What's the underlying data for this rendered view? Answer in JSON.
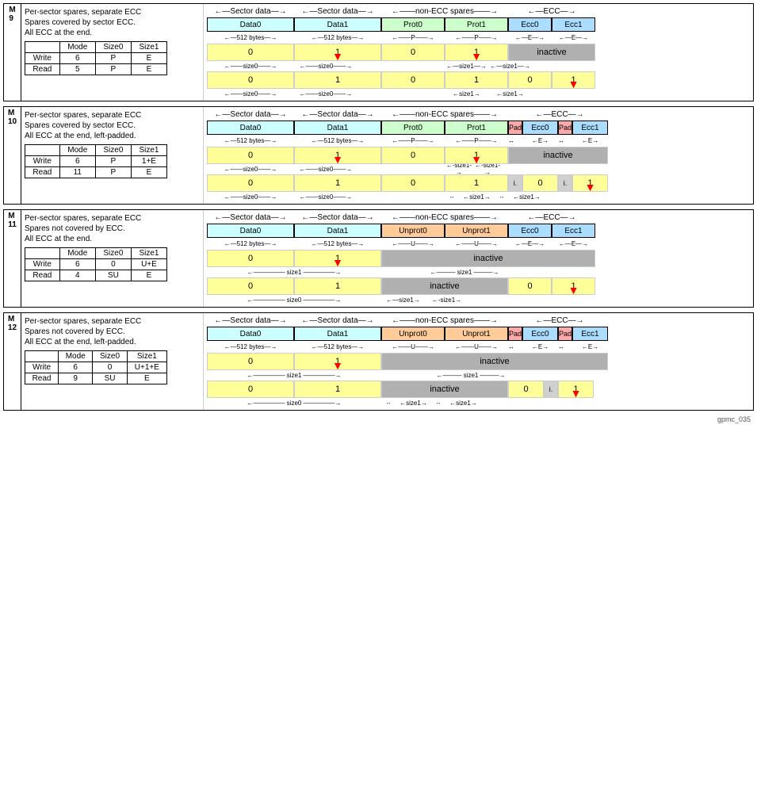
{
  "sections": [
    {
      "id": "M\n9",
      "title1": "Per-sector spares, separate ECC",
      "title2": "Spares covered by sector ECC.",
      "title3": "All ECC at the end.",
      "table": {
        "headers": [
          "Mode",
          "Size0",
          "Size1"
        ],
        "rows": [
          [
            "Write",
            "6",
            "P",
            "E"
          ],
          [
            "Read",
            "5",
            "P",
            "E"
          ]
        ]
      },
      "cols": [
        "Data0",
        "Data1",
        "Prot0",
        "Prot1",
        "Ecc0",
        "Ecc1"
      ],
      "col_types": [
        "data0",
        "data1",
        "prot0",
        "prot1",
        "ecc0",
        "ecc1"
      ],
      "write_row": [
        "0",
        "1",
        "0",
        "1",
        "inactive"
      ],
      "write_arrows": [
        false,
        true,
        false,
        true,
        false
      ],
      "read_row": [
        "0",
        "1",
        "0",
        "1",
        "0",
        "1"
      ],
      "read_arrows": [
        false,
        false,
        false,
        false,
        false,
        true
      ],
      "has_pad": false
    },
    {
      "id": "M\n10",
      "title1": "Per-sector spares, separate ECC",
      "title2": "Spares covered by sector ECC.",
      "title3": "All ECC at the end, left-padded.",
      "table": {
        "headers": [
          "Mode",
          "Size0",
          "Size1"
        ],
        "rows": [
          [
            "Write",
            "6",
            "P",
            "1+E"
          ],
          [
            "Read",
            "11",
            "P",
            "E"
          ]
        ]
      },
      "cols": [
        "Data0",
        "Data1",
        "Prot0",
        "Prot1",
        "Pad",
        "Ecc0",
        "Pad",
        "Ecc1"
      ],
      "col_types": [
        "data0",
        "data1",
        "prot0",
        "prot1",
        "pad",
        "ecc0",
        "pad",
        "ecc1"
      ],
      "write_row": [
        "0",
        "1",
        "0",
        "1",
        "inactive"
      ],
      "write_arrows": [
        false,
        true,
        false,
        true,
        false
      ],
      "read_row": [
        "0",
        "1",
        "0",
        "1",
        "i.",
        "0",
        "i.",
        "1"
      ],
      "read_arrows": [
        false,
        false,
        false,
        false,
        false,
        false,
        false,
        true
      ],
      "has_pad": true
    },
    {
      "id": "M\n11",
      "title1": "Per-sector spares, separate ECC",
      "title2": "Spares not covered by ECC.",
      "title3": "All ECC at the end.",
      "table": {
        "headers": [
          "Mode",
          "Size0",
          "Size1"
        ],
        "rows": [
          [
            "Write",
            "6",
            "0",
            "U+E"
          ],
          [
            "Read",
            "4",
            "SU",
            "E"
          ]
        ]
      },
      "cols": [
        "Data0",
        "Data1",
        "Unprot0",
        "Unprot1",
        "Ecc0",
        "Ecc1"
      ],
      "col_types": [
        "data0",
        "data1",
        "unprot0",
        "unprot1",
        "ecc0",
        "ecc1"
      ],
      "write_row": [
        "0",
        "1",
        "inactive"
      ],
      "write_arrows": [
        false,
        true,
        false
      ],
      "read_row": [
        "0",
        "1",
        "inactive",
        "0",
        "1"
      ],
      "read_arrows": [
        false,
        false,
        false,
        false,
        true
      ],
      "has_pad": false
    },
    {
      "id": "M\n12",
      "title1": "Per-sector spares, separate ECC",
      "title2": "Spares not covered by ECC.",
      "title3": "All ECC at the end, left-padded.",
      "table": {
        "headers": [
          "Mode",
          "Size0",
          "Size1"
        ],
        "rows": [
          [
            "Write",
            "6",
            "0",
            "U+1+E"
          ],
          [
            "Read",
            "9",
            "SU",
            "E"
          ]
        ]
      },
      "cols": [
        "Data0",
        "Data1",
        "Unprot0",
        "Unprot1",
        "Pad",
        "Ecc0",
        "Pad",
        "Ecc1"
      ],
      "col_types": [
        "data0",
        "data1",
        "unprot0",
        "unprot1",
        "pad",
        "ecc0",
        "pad",
        "ecc1"
      ],
      "write_row": [
        "0",
        "1",
        "inactive"
      ],
      "write_arrows": [
        false,
        true,
        false
      ],
      "read_row": [
        "0",
        "1",
        "inactive",
        "0",
        "i.",
        "1"
      ],
      "read_arrows": [
        false,
        false,
        false,
        false,
        false,
        true
      ],
      "has_pad": true
    }
  ],
  "footer": "gpmc_035"
}
